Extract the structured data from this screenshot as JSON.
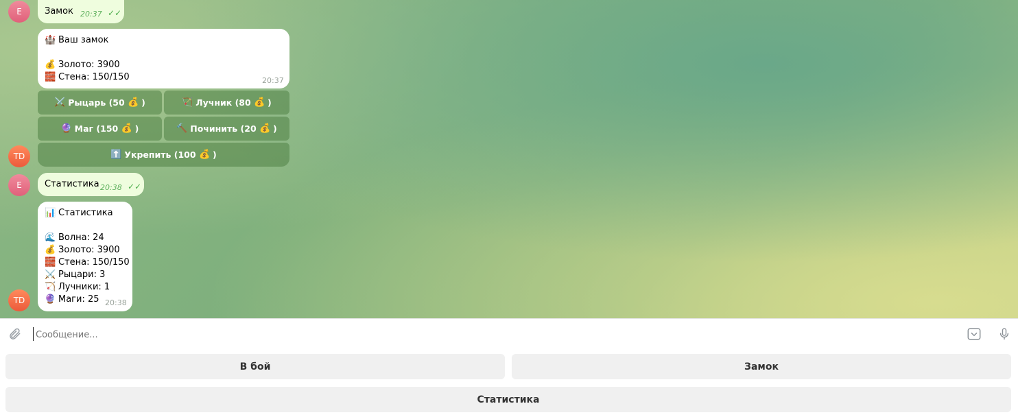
{
  "messages": {
    "m1": {
      "avatar": "E",
      "text": "Замок",
      "time": "20:37",
      "ticks": "✓✓"
    },
    "m2": {
      "avatar": "TD",
      "title_emoji": "🏰",
      "title": "Ваш замок",
      "gold_emoji": "💰",
      "gold": "Золото: 3900",
      "wall_emoji": "🧱",
      "wall": "Стена: 150/150",
      "time": "20:37",
      "buttons": [
        {
          "emoji": "⚔️",
          "label": "Рыцарь (50",
          "coin": "💰",
          "end": ")"
        },
        {
          "emoji": "🏹",
          "label": "Лучник (80",
          "coin": "💰",
          "end": ")"
        },
        {
          "emoji": "🔮",
          "label": "Маг (150",
          "coin": "💰",
          "end": ")"
        },
        {
          "emoji": "🔨",
          "label": "Починить (20",
          "coin": "💰",
          "end": ")"
        },
        {
          "emoji": "⬆️",
          "label": "Укрепить (100",
          "coin": "💰",
          "end": ")"
        }
      ]
    },
    "m3": {
      "avatar": "E",
      "text": "Статистика",
      "time": "20:38",
      "ticks": "✓✓"
    },
    "m4": {
      "avatar": "TD",
      "title_emoji": "📊",
      "title": "Статистика",
      "lines": [
        {
          "emoji": "🌊",
          "text": "Волна: 24"
        },
        {
          "emoji": "💰",
          "text": "Золото: 3900"
        },
        {
          "emoji": "🧱",
          "text": "Стена: 150/150"
        },
        {
          "emoji": "⚔️",
          "text": "Рыцари: 3"
        },
        {
          "emoji": "🏹",
          "text": "Лучники: 1"
        },
        {
          "emoji": "🔮",
          "text": "Маги: 25"
        }
      ],
      "time": "20:38"
    }
  },
  "input": {
    "placeholder": "Сообщение..."
  },
  "reply_keyboard": {
    "fight": "В бой",
    "castle": "Замок",
    "stats": "Статистика"
  },
  "icons": {
    "attach": "paperclip-icon",
    "keyboard": "keyboard-toggle-icon",
    "mic": "microphone-icon"
  }
}
